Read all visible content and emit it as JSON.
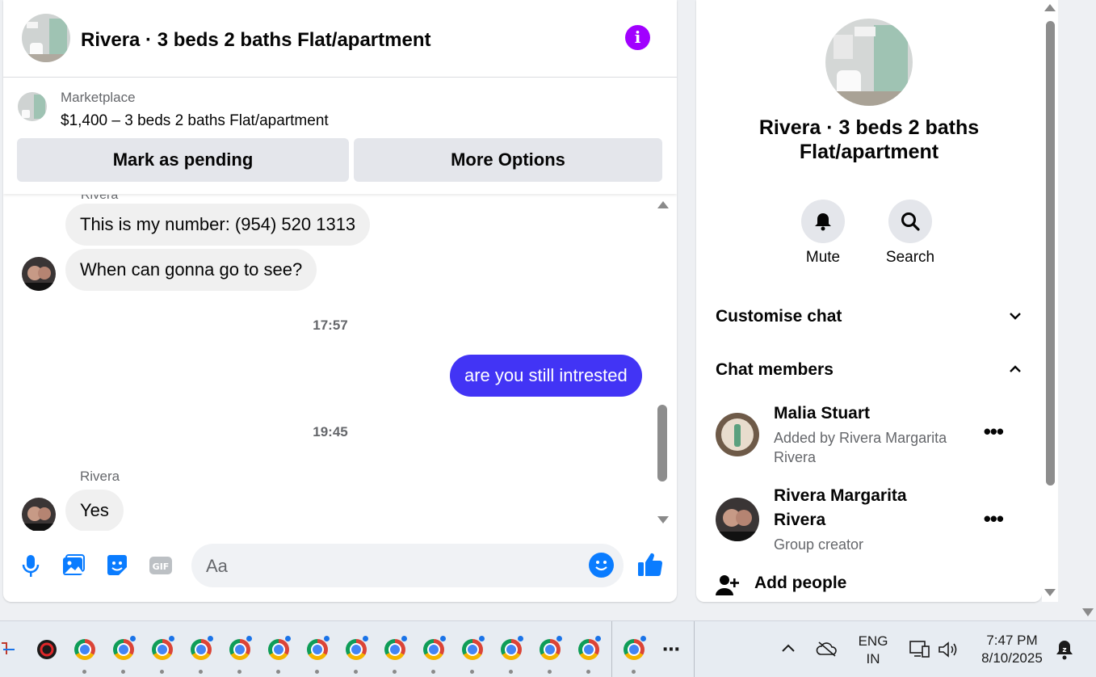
{
  "chat": {
    "title": "Rivera · 3 beds 2 baths Flat/apartment",
    "listing": {
      "label": "Marketplace",
      "price_text": "$1,400 – 3 beds 2 baths Flat/apartment",
      "btn_pending": "Mark as pending",
      "btn_more": "More Options"
    },
    "messages": {
      "sender_top": "Rivera",
      "msg1": "This is my number: (954) 520 1313",
      "msg2": "When can gonna go to see?",
      "time1": "17:57",
      "msg3": "are you still intrested",
      "time2": "19:45",
      "sender2": "Rivera",
      "msg4": "Yes"
    },
    "composer_placeholder": "Aa",
    "composer_icons": [
      "microphone-icon",
      "photo-icon",
      "sticker-icon",
      "gif-icon",
      "emoji-icon",
      "like-icon"
    ]
  },
  "side": {
    "title": "Rivera · 3 beds 2 baths Flat/apartment",
    "mute_label": "Mute",
    "search_label": "Search",
    "customise_label": "Customise chat",
    "members_label": "Chat members",
    "members": [
      {
        "name": "Malia Stuart",
        "sub": "Added by Rivera Margarita Rivera"
      },
      {
        "name": "Rivera Margarita Rivera",
        "sub": "Group creator"
      }
    ],
    "add_people": "Add people"
  },
  "taskbar": {
    "lang_line1": "ENG",
    "lang_line2": "IN",
    "time": "7:47 PM",
    "date": "8/10/2025",
    "more": "⋯"
  },
  "colors": {
    "accent_blue": "#0a7cff",
    "outgoing_bubble": "#4234f5",
    "info_purple": "#a100ff"
  }
}
